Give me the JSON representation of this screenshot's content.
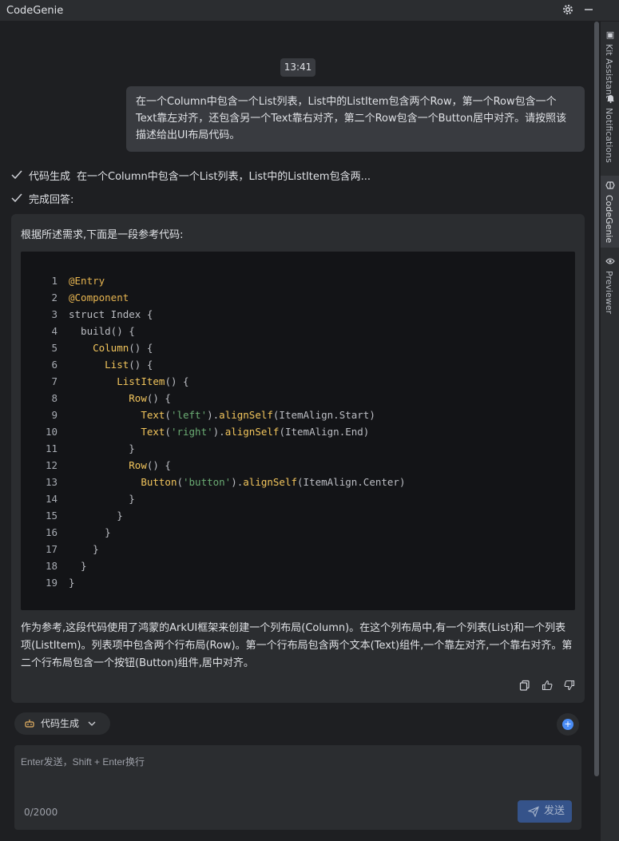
{
  "app": {
    "title": "CodeGenie"
  },
  "titlebar": {
    "settings_icon": "gear-icon",
    "minimize_icon": "minimize-icon"
  },
  "sidebar_tabs": [
    {
      "label": "Kit Assistant",
      "icon": "kit-icon"
    },
    {
      "label": "Notifications",
      "icon": "bell-icon"
    },
    {
      "label": "CodeGenie",
      "icon": "codegenie-icon"
    },
    {
      "label": "Previewer",
      "icon": "eye-icon"
    }
  ],
  "chat": {
    "timestamp": "13:41",
    "user_message": "在一个Column中包含一个List列表，List中的ListItem包含两个Row，第一个Row包含一个Text靠左对齐，还包含另一个Text靠右对齐，第二个Row包含一个Button居中对齐。请按照该描述给出UI布局代码。",
    "steps": [
      {
        "label": "代码生成",
        "detail": "在一个Column中包含一个List列表，List中的ListItem包含两..."
      },
      {
        "label": "完成回答:",
        "detail": ""
      }
    ],
    "answer": {
      "intro": "根据所述需求,下面是一段参考代码:",
      "code_lines": [
        {
          "num": "1",
          "text": "@Entry"
        },
        {
          "num": "2",
          "text": "@Component"
        },
        {
          "num": "3",
          "text": "struct Index {"
        },
        {
          "num": "4",
          "text": "  build() {"
        },
        {
          "num": "5",
          "text": "    Column() {"
        },
        {
          "num": "6",
          "text": "      List() {"
        },
        {
          "num": "7",
          "text": "        ListItem() {"
        },
        {
          "num": "8",
          "text": "          Row() {"
        },
        {
          "num": "9",
          "text": "            Text('left').alignSelf(ItemAlign.Start)"
        },
        {
          "num": "10",
          "text": "            Text('right').alignSelf(ItemAlign.End)"
        },
        {
          "num": "11",
          "text": "          }"
        },
        {
          "num": "12",
          "text": "          Row() {"
        },
        {
          "num": "13",
          "text": "            Button('button').alignSelf(ItemAlign.Center)"
        },
        {
          "num": "14",
          "text": "          }"
        },
        {
          "num": "15",
          "text": "        }"
        },
        {
          "num": "16",
          "text": "      }"
        },
        {
          "num": "17",
          "text": "    }"
        },
        {
          "num": "18",
          "text": "  }"
        },
        {
          "num": "19",
          "text": "}"
        }
      ],
      "summary": "作为参考,这段代码使用了鸿蒙的ArkUI框架来创建一个列布局(Column)。在这个列布局中,有一个列表(List)和一个列表项(ListItem)。列表项中包含两个行布局(Row)。第一个行布局包含两个文本(Text)组件,一个靠左对齐,一个靠右对齐。第二个行布局包含一个按钮(Button)组件,居中对齐。",
      "action_icons": [
        "copy-icon",
        "thumbs-up-icon",
        "thumbs-down-icon"
      ]
    }
  },
  "composer": {
    "mode_label": "代码生成",
    "placeholder": "Enter发送，Shift + Enter换行",
    "value": "",
    "counter": "0/2000",
    "send_label": "发送"
  },
  "colors": {
    "accent": "#35538a",
    "panel": "#2b2d30",
    "background": "#1e1f22",
    "code_bg": "#131417"
  }
}
